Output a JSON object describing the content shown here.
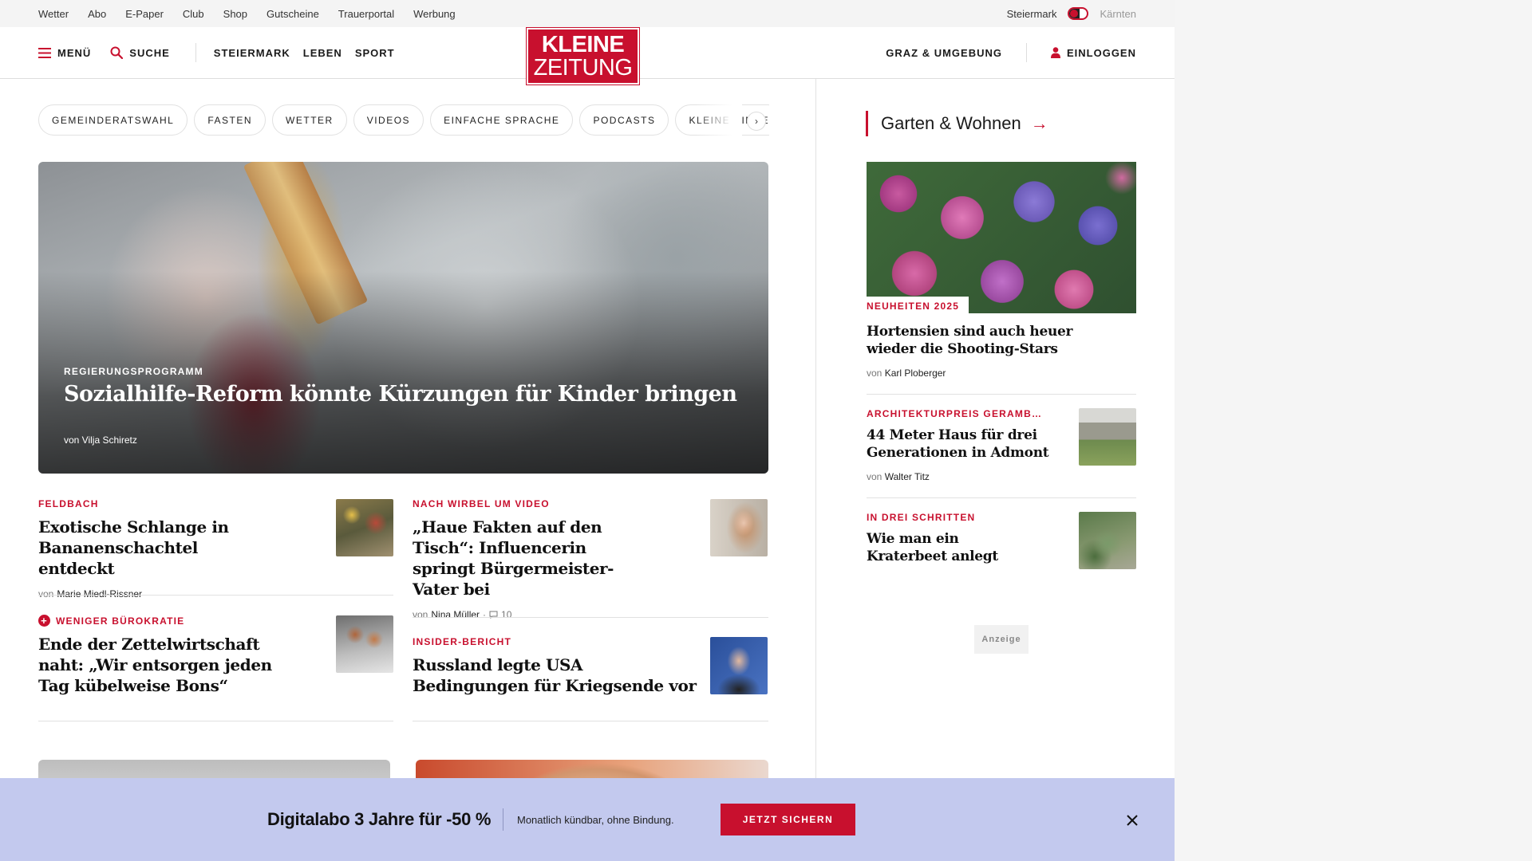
{
  "metabar": {
    "links": [
      "Wetter",
      "Abo",
      "E-Paper",
      "Club",
      "Shop",
      "Gutscheine",
      "Trauerportal",
      "Werbung"
    ],
    "region_active": "Steiermark",
    "region_inactive": "Kärnten"
  },
  "header": {
    "menu_label": "Menü",
    "search_label": "Suche",
    "nav": [
      "Steiermark",
      "Leben",
      "Sport"
    ],
    "logo_line1": "KLEINE",
    "logo_line2": "ZEITUNG",
    "region_link": "Graz & Umgebung",
    "login_label": "Einloggen"
  },
  "chips": [
    "Gemeinderatswahl",
    "Fasten",
    "Wetter",
    "Videos",
    "Einfache Sprache",
    "Podcasts",
    "Kleine Kinde"
  ],
  "hero": {
    "kicker": "Regierungsprogramm",
    "title": "Sozialhilfe-Reform könnte Kürzungen für Kinder bringen",
    "byline": "von Vilja Schiretz"
  },
  "articles": [
    {
      "kicker": "Feldbach",
      "title": "Exotische Schlange in Bananenschachtel entdeckt",
      "by": "von",
      "author": "Marie Miedl-Rissner"
    },
    {
      "kicker": "Nach Wirbel um Video",
      "title": "„Haue Fakten auf den Tisch“: Influencerin springt Bürgermeister-Vater bei",
      "by": "von",
      "author": "Nina Müller",
      "comments": "10"
    },
    {
      "kicker": "Weniger Bürokratie",
      "title": "Ende der Zettelwirtschaft naht: „Wir entsorgen jeden Tag kübelweise Bons“"
    },
    {
      "kicker": "Insider-Bericht",
      "title": "Russland legte USA Bedingungen für Kriegsende vor"
    }
  ],
  "sidebar": {
    "heading": "Garten & Wohnen",
    "items": [
      {
        "kicker": "Neuheiten 2025",
        "title": "Hortensien sind auch heuer wieder die Shooting-Stars",
        "by": "von",
        "author": "Karl Ploberger"
      },
      {
        "kicker": "Architekturpreis Geramb…",
        "title": "44 Meter Haus für drei Generationen in Admont",
        "by": "von",
        "author": "Walter Titz"
      },
      {
        "kicker": "In drei Schritten",
        "title": "Wie man ein Kraterbeet anlegt"
      }
    ],
    "ad_label": "Anzeige"
  },
  "promo": {
    "headline": "Digitalabo 3 Jahre für -50 %",
    "sub": "Monatlich kündbar, ohne Bindung.",
    "cta": "Jetzt sichern"
  },
  "colors": {
    "brand_red": "#c8102e",
    "promo_bg": "#c3c9ee"
  },
  "icons": [
    "hamburger-icon",
    "search-icon",
    "user-icon",
    "chevron-right-icon",
    "arrow-right-icon",
    "comment-icon",
    "plus-icon",
    "close-icon"
  ]
}
